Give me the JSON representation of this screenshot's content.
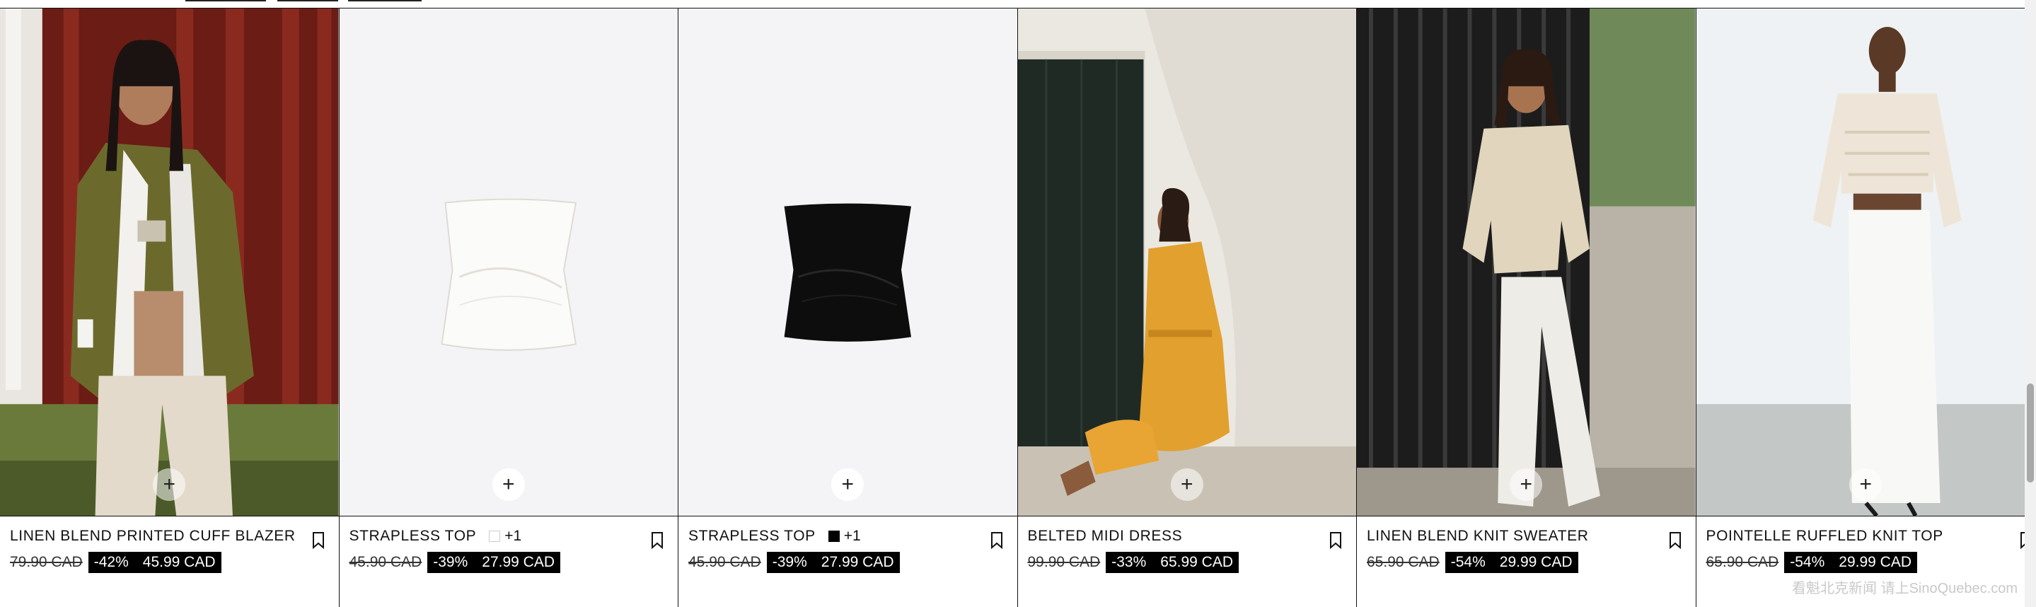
{
  "products": [
    {
      "name": "LINEN BLEND PRINTED CUFF BLAZER",
      "old_price": "79.90 CAD",
      "discount": "-42%",
      "sale_price": "45.99 CAD",
      "image_desc": "model in olive linen blazer and cream trousers"
    },
    {
      "name": "STRAPLESS TOP",
      "swatch": "white",
      "more_colors": "+1",
      "old_price": "45.90 CAD",
      "discount": "-39%",
      "sale_price": "27.99 CAD",
      "image_desc": "white strapless top on light grey background"
    },
    {
      "name": "STRAPLESS TOP",
      "swatch": "black",
      "more_colors": "+1",
      "old_price": "45.90 CAD",
      "discount": "-39%",
      "sale_price": "27.99 CAD",
      "image_desc": "black strapless top on light grey background"
    },
    {
      "name": "BELTED MIDI DRESS",
      "old_price": "99.90 CAD",
      "discount": "-33%",
      "sale_price": "65.99 CAD",
      "image_desc": "model in mustard belted midi dress against white wall"
    },
    {
      "name": "LINEN BLEND KNIT SWEATER",
      "old_price": "65.90 CAD",
      "discount": "-54%",
      "sale_price": "29.99 CAD",
      "image_desc": "model in beige knit sweater leaning on black railing"
    },
    {
      "name": "POINTELLE RUFFLED KNIT TOP",
      "old_price": "65.90 CAD",
      "discount": "-54%",
      "sale_price": "29.99 CAD",
      "image_desc": "model in cream pointelle top and white maxi skirt"
    }
  ],
  "quick_add_symbol": "+",
  "watermark": "看魁北克新闻 请上SinoQuebec.com",
  "colors": {
    "border": "#111111",
    "sale_bg": "#000000",
    "sale_text": "#ffffff",
    "studio_bg": "#f4f4f6"
  }
}
